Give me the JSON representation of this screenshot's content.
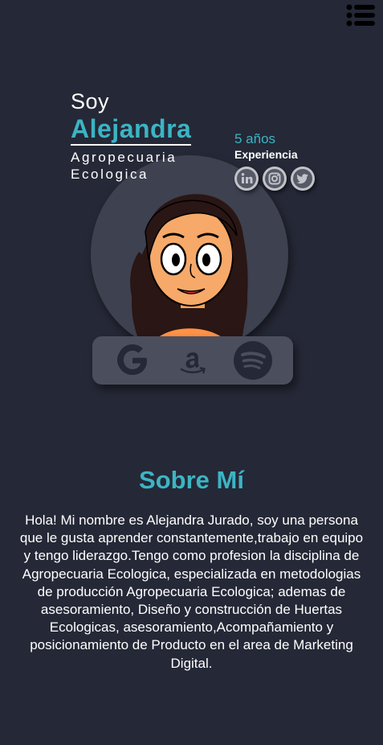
{
  "nav": {
    "menu_icon": "menu-list-icon"
  },
  "hero": {
    "greeting": "Soy",
    "name": "Alejandra",
    "role_line1": "Agropecuaria",
    "role_line2": "Ecologica",
    "experience_years": "5 años",
    "experience_label": "Experiencia",
    "socials": [
      "linkedin-icon",
      "instagram-icon",
      "twitter-icon"
    ],
    "brands": [
      "google-icon",
      "amazon-icon",
      "spotify-icon"
    ]
  },
  "about": {
    "title": "Sobre Mí",
    "text": "Hola! Mi nombre es Alejandra Jurado, soy una persona que le gusta aprender constantemente,trabajo en equipo y tengo liderazgo.Tengo como profesion la disciplina de Agropecuaria Ecologica, especializada en metodologias de producción Agropecuaria Ecologica; ademas de asesoramiento, Diseño y construcción de Huertas Ecologicas, asesoramiento,Acompañamiento y posicionamiento de Producto en el area de Marketing Digital."
  },
  "colors": {
    "background": "#252836",
    "accent": "#3cb4c4",
    "card": "#4b4f5d"
  }
}
